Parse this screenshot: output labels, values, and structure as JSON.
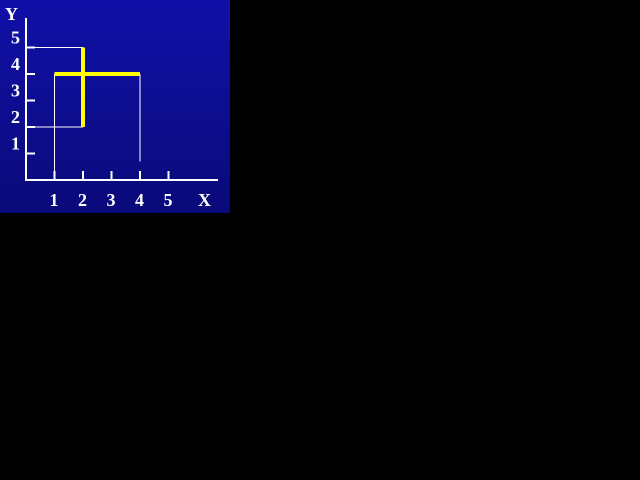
{
  "background_color": "#000000",
  "panel": {
    "gradient_top": "#1010a8",
    "gradient_bottom": "#0a0a7a"
  },
  "axes": {
    "x_title": "X",
    "y_title": "Y",
    "x_ticks": [
      "1",
      "2",
      "3",
      "4",
      "5"
    ],
    "y_ticks": [
      "1",
      "2",
      "3",
      "4",
      "5"
    ],
    "axis_color": "#ffffff"
  },
  "segments": {
    "color_highlight": "#ffff00",
    "color_guide": "#ffffff",
    "vertical_highlight": {
      "x": 2,
      "y1": 2,
      "y2": 5
    },
    "horizontal_highlight": {
      "y": 4,
      "x1": 1,
      "x2": 4
    },
    "guides": [
      {
        "from": [
          0,
          5
        ],
        "to": [
          2,
          5
        ]
      },
      {
        "from": [
          0,
          2
        ],
        "to": [
          2,
          2
        ]
      },
      {
        "from": [
          1,
          0
        ],
        "to": [
          1,
          4
        ]
      },
      {
        "from": [
          4,
          0.7
        ],
        "to": [
          4,
          4
        ]
      }
    ]
  }
}
